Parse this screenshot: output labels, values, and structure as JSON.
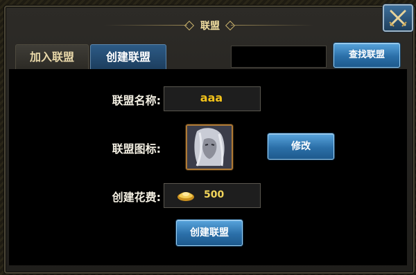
{
  "dialog": {
    "title": "联盟"
  },
  "tabs": [
    {
      "label": "加入联盟",
      "active": false
    },
    {
      "label": "创建联盟",
      "active": true
    }
  ],
  "search": {
    "value": "",
    "button_label": "查找联盟"
  },
  "form": {
    "name_label": "联盟名称:",
    "name_value": "aaa",
    "icon_label": "联盟图标:",
    "modify_label": "修改",
    "cost_label": "创建花费:",
    "cost_value": "500",
    "create_label": "创建联盟"
  },
  "icons": {
    "close": "close-swords-icon",
    "currency": "gold-ingot-icon",
    "guild_emblem": "white-haired-hero-portrait"
  },
  "colors": {
    "accent_blue": "#2b6fa8",
    "gold_text": "#f2c21a",
    "title_gold": "#f1dea0"
  }
}
